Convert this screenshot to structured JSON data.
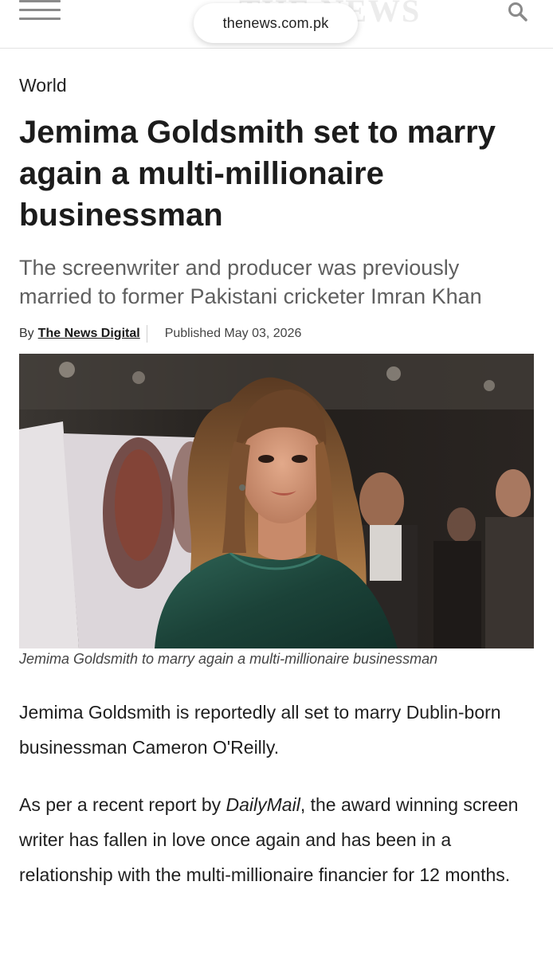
{
  "browser": {
    "url": "thenews.com.pk",
    "logo_text": "THE NEWS"
  },
  "icons": {
    "menu": "hamburger-menu-icon",
    "search": "search-icon"
  },
  "article": {
    "category": "World",
    "headline": "Jemima Goldsmith set to marry again a multi-millionaire businessman",
    "subheadline": "The screenwriter and producer was previously married to former Pakistani cricketer Imran Khan",
    "byline_prefix": "By",
    "author": "The News Digital",
    "published": "Published May 03, 2026",
    "image_caption": "Jemima Goldsmith to marry again a multi-millionaire businessman",
    "paragraph1": "Jemima Goldsmith is reportedly all set to marry Dublin-born businessman Cameron O'Reilly.",
    "paragraph2_before": "As per a recent report by ",
    "paragraph2_source": "DailyMail",
    "paragraph2_after": ", the award winning screen writer has fallen in love once again and has been in a relationship with the multi-millionaire financier for 12 months."
  },
  "colors": {
    "headline": "#1c1c1c",
    "subheadline": "#5f5f5f",
    "icon_gray": "#8a8a8a",
    "dress_green": "#1f4a40",
    "hair_brown": "#8a5a30"
  }
}
